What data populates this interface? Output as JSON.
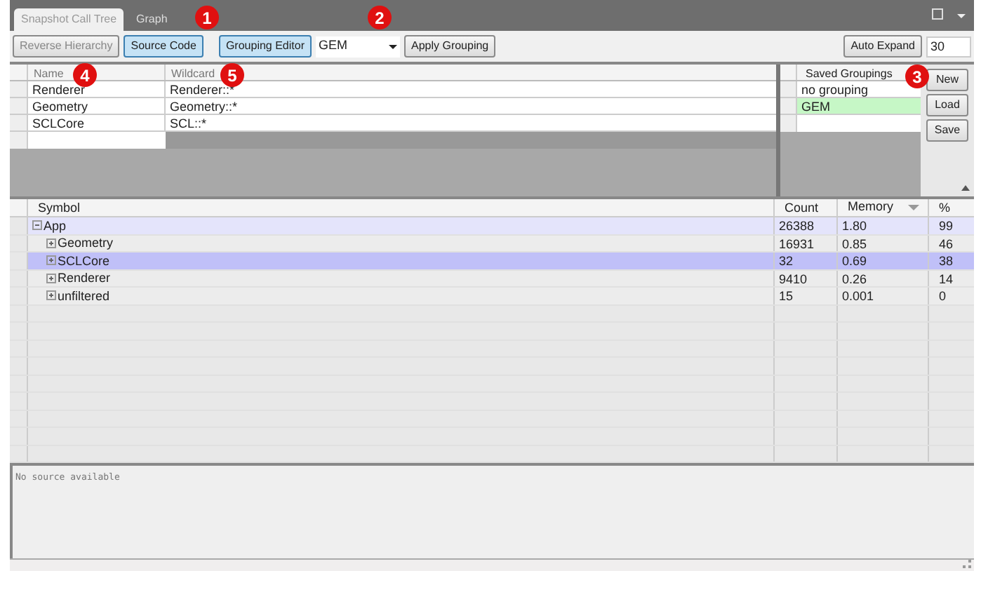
{
  "tabs": [
    {
      "label": "Snapshot Call Tree",
      "selected": true
    },
    {
      "label": "Graph",
      "selected": false
    }
  ],
  "toolbar": {
    "reverse_hierarchy": "Reverse Hierarchy",
    "source_code": "Source Code",
    "grouping_editor": "Grouping Editor",
    "grouping_select": "GEM",
    "apply_grouping": "Apply Grouping",
    "auto_expand": "Auto Expand",
    "auto_expand_value": "30"
  },
  "grouping_table": {
    "columns": [
      "Name",
      "Wildcard"
    ],
    "rows": [
      {
        "name": "Renderer",
        "wildcard": "Renderer::*"
      },
      {
        "name": "Geometry",
        "wildcard": "Geometry::*"
      },
      {
        "name": "SCLCore",
        "wildcard": "SCL::*"
      }
    ]
  },
  "saved_groupings": {
    "title": "Saved Groupings",
    "items": [
      {
        "label": "no grouping",
        "selected": false
      },
      {
        "label": "GEM",
        "selected": true
      }
    ],
    "buttons": [
      "New",
      "Load",
      "Save"
    ]
  },
  "callouts": [
    "1",
    "2",
    "4",
    "5",
    "3"
  ],
  "tree": {
    "columns": [
      "Symbol",
      "Count",
      "Memory",
      "%"
    ],
    "rows": [
      {
        "symbol": "App",
        "count": "26388",
        "memory": "1.80",
        "percent": "99",
        "expanded": true,
        "selected": false,
        "children": [
          {
            "symbol": "Geometry",
            "count": "16931",
            "memory": "0.85",
            "percent": "46",
            "expanded": false,
            "selected": false
          },
          {
            "symbol": "SCLCore",
            "count": "32",
            "memory": "0.69",
            "percent": "38",
            "expanded": false,
            "selected": true
          },
          {
            "symbol": "Renderer",
            "count": "9410",
            "memory": "0.26",
            "percent": "14",
            "expanded": false,
            "selected": false
          },
          {
            "symbol": "unfiltered",
            "count": "15",
            "memory": "0.001",
            "percent": "0",
            "expanded": false,
            "selected": false
          }
        ]
      }
    ]
  },
  "source_panel": {
    "text": "No source available"
  }
}
